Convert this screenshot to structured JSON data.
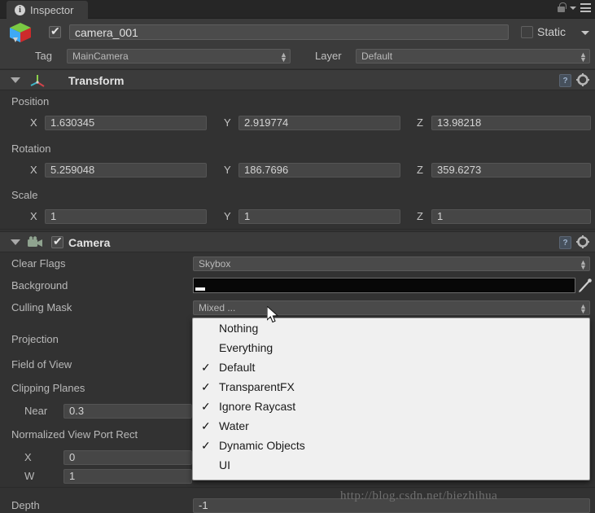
{
  "window": {
    "tab_label": "Inspector",
    "tab_icon": "info-icon",
    "lock_icon": "lock-icon",
    "menu_icon": "hamburger-menu-icon"
  },
  "object_header": {
    "enabled_checkbox": true,
    "name": "camera_001",
    "static_label": "Static",
    "static_checked": false,
    "prefab_icon": "cube-icon"
  },
  "tag_layer": {
    "tag_label": "Tag",
    "tag_value": "MainCamera",
    "layer_label": "Layer",
    "layer_value": "Default"
  },
  "transform": {
    "title": "Transform",
    "icon": "transform-axis-icon",
    "help_icon": "help-book-icon",
    "gear_icon": "gear-icon",
    "position": {
      "label": "Position",
      "x_label": "X",
      "x": "1.630345",
      "y_label": "Y",
      "y": "2.919774",
      "z_label": "Z",
      "z": "13.98218"
    },
    "rotation": {
      "label": "Rotation",
      "x_label": "X",
      "x": "5.259048",
      "y_label": "Y",
      "y": "186.7696",
      "z_label": "Z",
      "z": "359.6273"
    },
    "scale": {
      "label": "Scale",
      "x_label": "X",
      "x": "1",
      "y_label": "Y",
      "y": "1",
      "z_label": "Z",
      "z": "1"
    }
  },
  "camera": {
    "title": "Camera",
    "enabled_checkbox": true,
    "icon": "camera-icon",
    "help_icon": "help-book-icon",
    "gear_icon": "gear-icon",
    "clear_flags_label": "Clear Flags",
    "clear_flags_value": "Skybox",
    "background_label": "Background",
    "background_color": "#070707",
    "eyedropper_icon": "eyedropper-icon",
    "culling_mask_label": "Culling Mask",
    "culling_mask_value": "Mixed ...",
    "projection_label": "Projection",
    "field_of_view_label": "Field of View",
    "clipping_planes_label": "Clipping Planes",
    "near_label": "Near",
    "near_value": "0.3",
    "viewport_rect_label": "Normalized View Port Rect",
    "viewport_x_label": "X",
    "viewport_x_value": "0",
    "viewport_w_label": "W",
    "viewport_w_value": "1",
    "depth_label": "Depth",
    "depth_value": "-1"
  },
  "culling_mask_menu": {
    "items": [
      {
        "label": "Nothing",
        "checked": false
      },
      {
        "label": "Everything",
        "checked": false
      },
      {
        "label": "Default",
        "checked": true
      },
      {
        "label": "TransparentFX",
        "checked": true
      },
      {
        "label": "Ignore Raycast",
        "checked": true
      },
      {
        "label": "Water",
        "checked": true
      },
      {
        "label": "Dynamic Objects",
        "checked": true
      },
      {
        "label": "UI",
        "checked": false
      }
    ],
    "check_glyph": "✓"
  },
  "cursor": {
    "icon": "mouse-pointer-icon"
  },
  "watermark": {
    "text": "http://blog.csdn.net/biezhihua"
  },
  "colors": {
    "panel_bg": "#323232",
    "header_bg": "#3b3b3b",
    "tabbar_bg": "#262626",
    "field_bg": "#464646",
    "text": "#b9b9b9",
    "menu_bg": "#f0f0f0",
    "menu_text": "#1a1a1a"
  }
}
